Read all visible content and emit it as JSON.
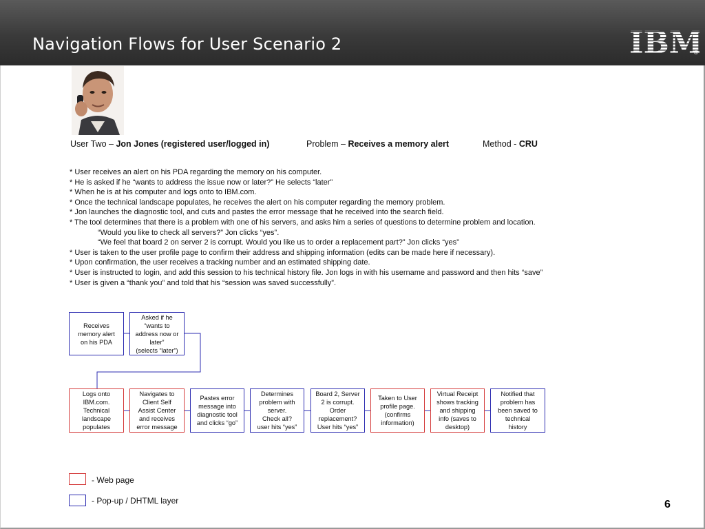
{
  "slide": {
    "title": "Navigation Flows for User Scenario 2",
    "logo_text": "IBM",
    "logo_mark": "®",
    "page_number": "6"
  },
  "user": {
    "prefix": "User Two – ",
    "name": "Jon Jones (registered user/logged in)",
    "problem_prefix": "Problem – ",
    "problem": "Receives a memory alert",
    "method_prefix": "Method - ",
    "method": "CRU"
  },
  "bullets": [
    "* User receives an alert on his PDA regarding the memory on his computer.",
    "* He is asked if he “wants to address the issue now or later?”  He selects “later”",
    "* When he is at his computer and logs onto to IBM.com.",
    "* Once the technical landscape populates, he receives the alert on his computer regarding the memory problem.",
    "* Jon launches the diagnostic tool, and cuts and pastes the error message that he received into the search field.",
    "* The tool determines that there is a problem with one of his servers, and asks him a series of questions to determine problem and location.",
    "“Would you like to check all servers?”  Jon clicks “yes”.",
    "“We feel that board 2 on server 2 is corrupt.  Would you like us to order a replacement part?”  Jon clicks “yes”",
    "* User is taken to the user profile page to confirm their address and shipping information (edits can be made here if necessary).",
    "* Upon confirmation, the user receives a tracking number and an estimated shipping date.",
    "* User is instructed to login, and add this session to his technical history file.  Jon logs in with his username and password and then hits “save”",
    "* User is given a “thank you” and told that his “session was saved successfully”."
  ],
  "flow": {
    "row1": [
      {
        "text": "Receives\nmemory alert\non his PDA",
        "kind": "popup"
      },
      {
        "text": "Asked if he\n“wants to\naddress now or\nlater”\n(selects “later”)",
        "kind": "popup"
      }
    ],
    "row2": [
      {
        "text": "Logs onto\nIBM.com.\nTechnical\nlandscape\npopulates",
        "kind": "web"
      },
      {
        "text": "Navigates to\nClient Self\nAssist Center\nand receives\nerror message",
        "kind": "web"
      },
      {
        "text": "Pastes error\nmessage into\ndiagnostic tool\nand clicks “go”",
        "kind": "popup"
      },
      {
        "text": "Determines\nproblem with\nserver.\nCheck all?\nuser hits “yes”",
        "kind": "popup"
      },
      {
        "text": "Board 2, Server\n2 is corrupt.\nOrder\nreplacement?\nUser hits “yes”",
        "kind": "popup"
      },
      {
        "text": "Taken to User\nprofile page.\n(confirms\ninformation)",
        "kind": "web"
      },
      {
        "text": "Virtual Receipt\nshows tracking\nand  shipping\ninfo (saves to\ndesktop)",
        "kind": "web"
      },
      {
        "text": "Notified that\nproblem has\nbeen saved to\ntechnical\nhistory",
        "kind": "popup"
      }
    ]
  },
  "legend": {
    "web": "- Web page",
    "popup": "- Pop-up / DHTML layer"
  },
  "colors": {
    "web_border": "#d43a3a",
    "popup_border": "#2b2bb0",
    "connector": "#2b2bb0",
    "header_bg": "#3a3a3a"
  },
  "icons": {
    "photo": "man-on-phone-photo"
  }
}
